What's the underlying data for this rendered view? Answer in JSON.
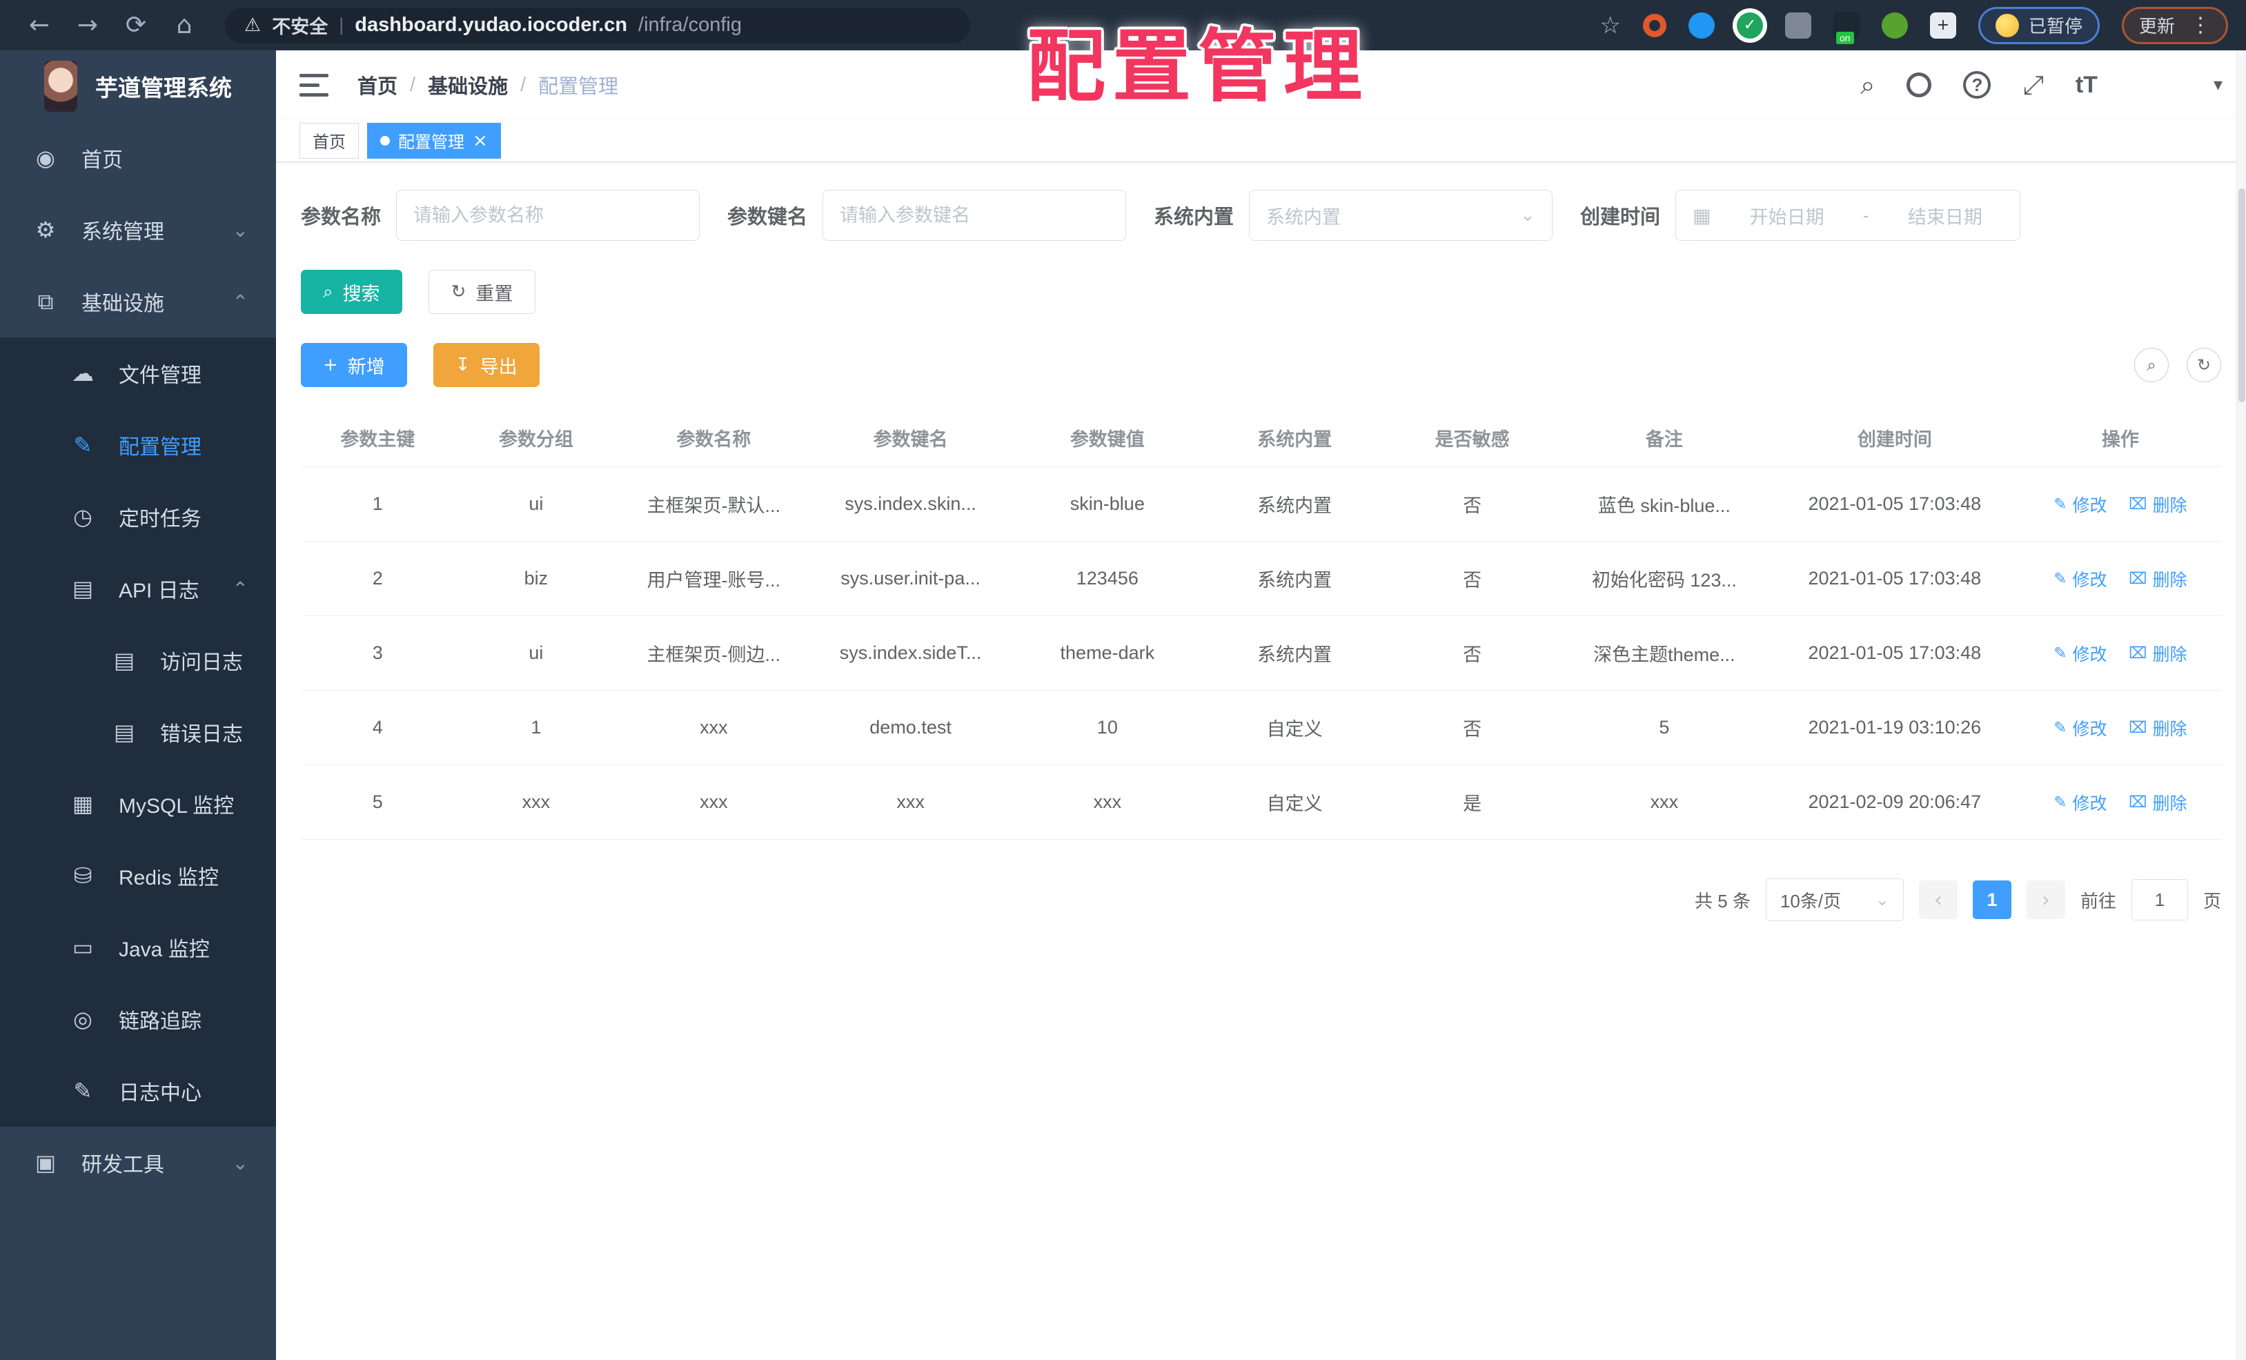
{
  "overlay_title": "配置管理",
  "browser": {
    "security_label": "不安全",
    "url_host": "dashboard.yudao.iocoder.cn",
    "url_path": "/infra/config",
    "paused_badge_label": "已暂停",
    "update_button_label": "更新"
  },
  "icons": {
    "back": "←",
    "forward": "→",
    "reload": "⟳",
    "home": "⌂",
    "warning": "⚠",
    "bookmark_star": "☆",
    "more_vertical": "⋮",
    "check": "✓",
    "puzzle": "+",
    "search": "⌕",
    "fullscreen": "⤢",
    "font_size": "tT",
    "caret_down": "▾",
    "help": "?",
    "dashboard": "◉",
    "gear": "⚙",
    "infrastructure": "⧉",
    "cloud_upload": "☁",
    "edit": "✎",
    "timer": "◷",
    "log": "▤",
    "grid": "▦",
    "redis": "⛁",
    "java": "▭",
    "eye": "◎",
    "briefcase": "▣",
    "chevron_down": "⌄",
    "chevron_up": "⌃",
    "plus": "+",
    "refresh": "↻",
    "download": "↧",
    "calendar": "▦",
    "close": "×",
    "dot": "●",
    "delete": "⌧",
    "prev": "‹",
    "next": "›"
  },
  "sidebar": {
    "app_title": "芋道管理系统",
    "items": [
      {
        "label": "首页"
      },
      {
        "label": "系统管理"
      },
      {
        "label": "基础设施"
      },
      {
        "label": "文件管理"
      },
      {
        "label": "配置管理"
      },
      {
        "label": "定时任务"
      },
      {
        "label": "API 日志"
      },
      {
        "label": "访问日志"
      },
      {
        "label": "错误日志"
      },
      {
        "label": "MySQL 监控"
      },
      {
        "label": "Redis 监控"
      },
      {
        "label": "Java 监控"
      },
      {
        "label": "链路追踪"
      },
      {
        "label": "日志中心"
      },
      {
        "label": "研发工具"
      }
    ]
  },
  "breadcrumb": {
    "items": [
      "首页",
      "基础设施",
      "配置管理"
    ],
    "separator": "/"
  },
  "tabs": [
    {
      "label": "首页"
    },
    {
      "label": "配置管理"
    }
  ],
  "filters": {
    "name_label": "参数名称",
    "name_placeholder": "请输入参数名称",
    "key_label": "参数键名",
    "key_placeholder": "请输入参数键名",
    "type_label": "系统内置",
    "type_placeholder": "系统内置",
    "date_label": "创建时间",
    "date_start_placeholder": "开始日期",
    "date_separator": "-",
    "date_end_placeholder": "结束日期"
  },
  "toolbar": {
    "search_label": "搜索",
    "reset_label": "重置",
    "add_label": "新增",
    "export_label": "导出"
  },
  "table": {
    "columns": [
      "参数主键",
      "参数分组",
      "参数名称",
      "参数键名",
      "参数键值",
      "系统内置",
      "是否敏感",
      "备注",
      "创建时间",
      "操作"
    ],
    "edit_label": "修改",
    "delete_label": "删除",
    "rows": [
      [
        "1",
        "ui",
        "主框架页-默认...",
        "sys.index.skin...",
        "skin-blue",
        "系统内置",
        "否",
        "蓝色 skin-blue...",
        "2021-01-05 17:03:48"
      ],
      [
        "2",
        "biz",
        "用户管理-账号...",
        "sys.user.init-pa...",
        "123456",
        "系统内置",
        "否",
        "初始化密码 123...",
        "2021-01-05 17:03:48"
      ],
      [
        "3",
        "ui",
        "主框架页-侧边...",
        "sys.index.sideT...",
        "theme-dark",
        "系统内置",
        "否",
        "深色主题theme...",
        "2021-01-05 17:03:48"
      ],
      [
        "4",
        "1",
        "xxx",
        "demo.test",
        "10",
        "自定义",
        "否",
        "5",
        "2021-01-19 03:10:26"
      ],
      [
        "5",
        "xxx",
        "xxx",
        "xxx",
        "xxx",
        "自定义",
        "是",
        "xxx",
        "2021-02-09 20:06:47"
      ]
    ]
  },
  "pagination": {
    "total_text": "共 5 条",
    "page_size_text": "10条/页",
    "current_page": "1",
    "goto_label": "前往",
    "goto_value": "1",
    "page_unit_label": "页"
  },
  "colors": {
    "primary": "#409eff",
    "teal": "#17b3a3",
    "warning": "#f0a63a",
    "overlay_red": "#f2365f",
    "sidebar_bg": "#304156",
    "submenu_bg": "#1f2d3d"
  }
}
